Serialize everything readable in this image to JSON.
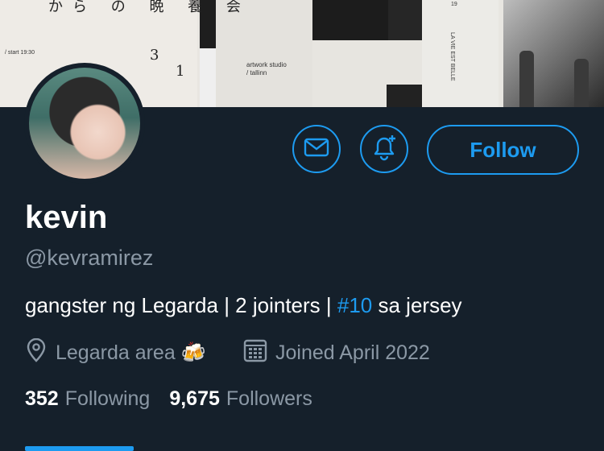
{
  "banner": {
    "japanese_text": "から の 晩 養 会",
    "number_a": "3",
    "number_b": "1",
    "studio_title": "artwork studio",
    "studio_sub": "/ tallinn",
    "small_a": "/ start 19:30",
    "small_b": "LA VIE EST BELLE",
    "small_c": "19"
  },
  "profile": {
    "name": "kevin",
    "handle": "@kevramirez",
    "bio_prefix": "gangster ng Legarda | 2 jointers | ",
    "bio_hashtag": "#10",
    "bio_suffix": " sa jersey",
    "location": "Legarda area 🍻",
    "joined": "Joined April 2022",
    "following_count": "352",
    "following_label": "Following",
    "followers_count": "9,675",
    "followers_label": "Followers"
  },
  "actions": {
    "follow_label": "Follow"
  },
  "colors": {
    "accent": "#1d9bf0",
    "background": "#15202b",
    "muted": "#8b98a5"
  },
  "icons": [
    "mail-icon",
    "bell-plus-icon",
    "location-pin-icon",
    "calendar-icon"
  ]
}
